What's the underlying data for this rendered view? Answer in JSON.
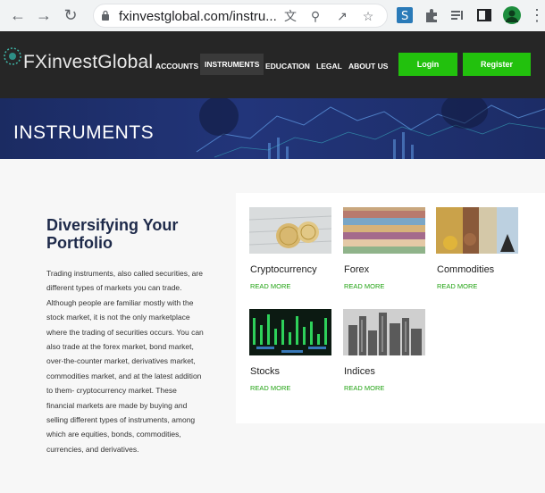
{
  "browser": {
    "url": "fxinvestglobal.com/instru...",
    "icons": [
      "back-arrow-icon",
      "forward-arrow-icon",
      "reload-icon",
      "lock-icon",
      "translate-icon",
      "zoom-icon",
      "share-icon",
      "bookmark-star-icon",
      "extension-s-icon",
      "puzzle-icon",
      "media-icon",
      "side-panel-icon",
      "profile-icon",
      "menu-icon"
    ]
  },
  "header": {
    "logo": "FXinvestGlobal",
    "nav": [
      "ACCOUNTS",
      "INSTRUMENTS",
      "EDUCATION",
      "LEGAL",
      "ABOUT US"
    ],
    "login_label": "Login",
    "register_label": "Register",
    "accent_color": "#22c10d"
  },
  "banner": {
    "title": "INSTRUMENTS"
  },
  "content": {
    "heading": "Diversifying Your Portfolio",
    "paragraph": "Trading instruments, also called securities, are different types of markets you can trade. Although people are familiar mostly with the stock market, it is not the only marketplace where the trading of securities occurs. You can also trade at the forex market, bond market, over-the-counter market, derivatives market, commodities market, and at the latest addition to them- cryptocurrency market. These financial markets are made by buying and selling different types of instruments, among which are equities, bonds, commodities, currencies, and derivatives."
  },
  "instruments": [
    {
      "name": "Cryptocurrency",
      "link": "READ MORE"
    },
    {
      "name": "Forex",
      "link": "READ MORE"
    },
    {
      "name": "Commodities",
      "link": "READ MORE"
    },
    {
      "name": "Stocks",
      "link": "READ MORE"
    },
    {
      "name": "Indices",
      "link": "READ MORE"
    }
  ]
}
